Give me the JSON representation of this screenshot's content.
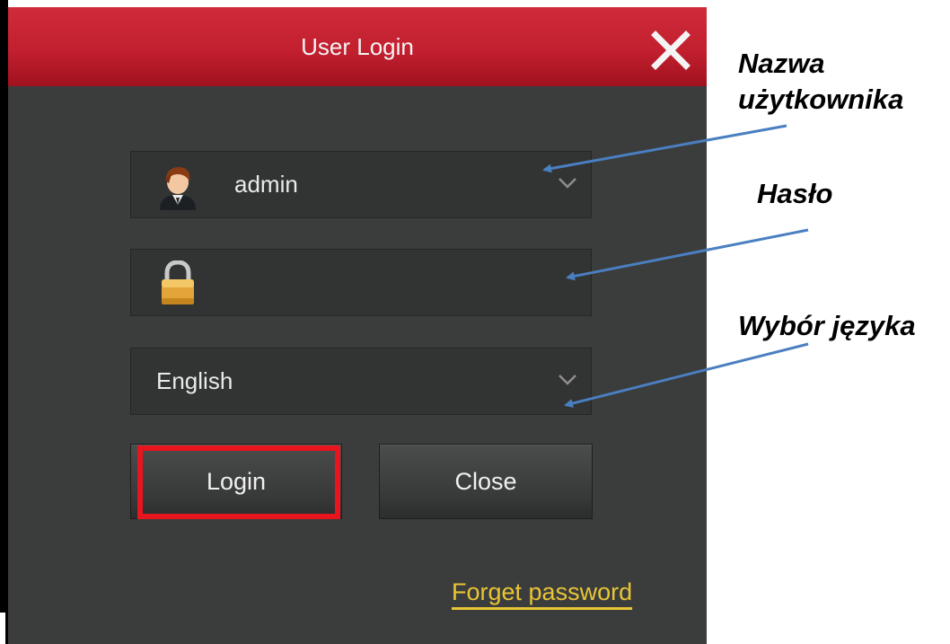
{
  "dialog": {
    "title": "User Login",
    "username": {
      "value": "admin",
      "icon": "user-avatar-icon"
    },
    "password": {
      "value": "",
      "icon": "lock-icon"
    },
    "language": {
      "value": "English"
    },
    "buttons": {
      "login_label": "Login",
      "close_label": "Close"
    },
    "forget_password_label": "Forget password"
  },
  "annotations": {
    "username_line1": "Nazwa",
    "username_line2": "użytkownika",
    "password": "Hasło",
    "language": "Wybór języka"
  },
  "colors": {
    "titlebar": "#c21f2f",
    "dialog_bg": "#3b3c3c",
    "field_bg": "#323333",
    "link": "#e8c535",
    "highlight": "#e8141e",
    "arrow": "#4a7fc1"
  }
}
